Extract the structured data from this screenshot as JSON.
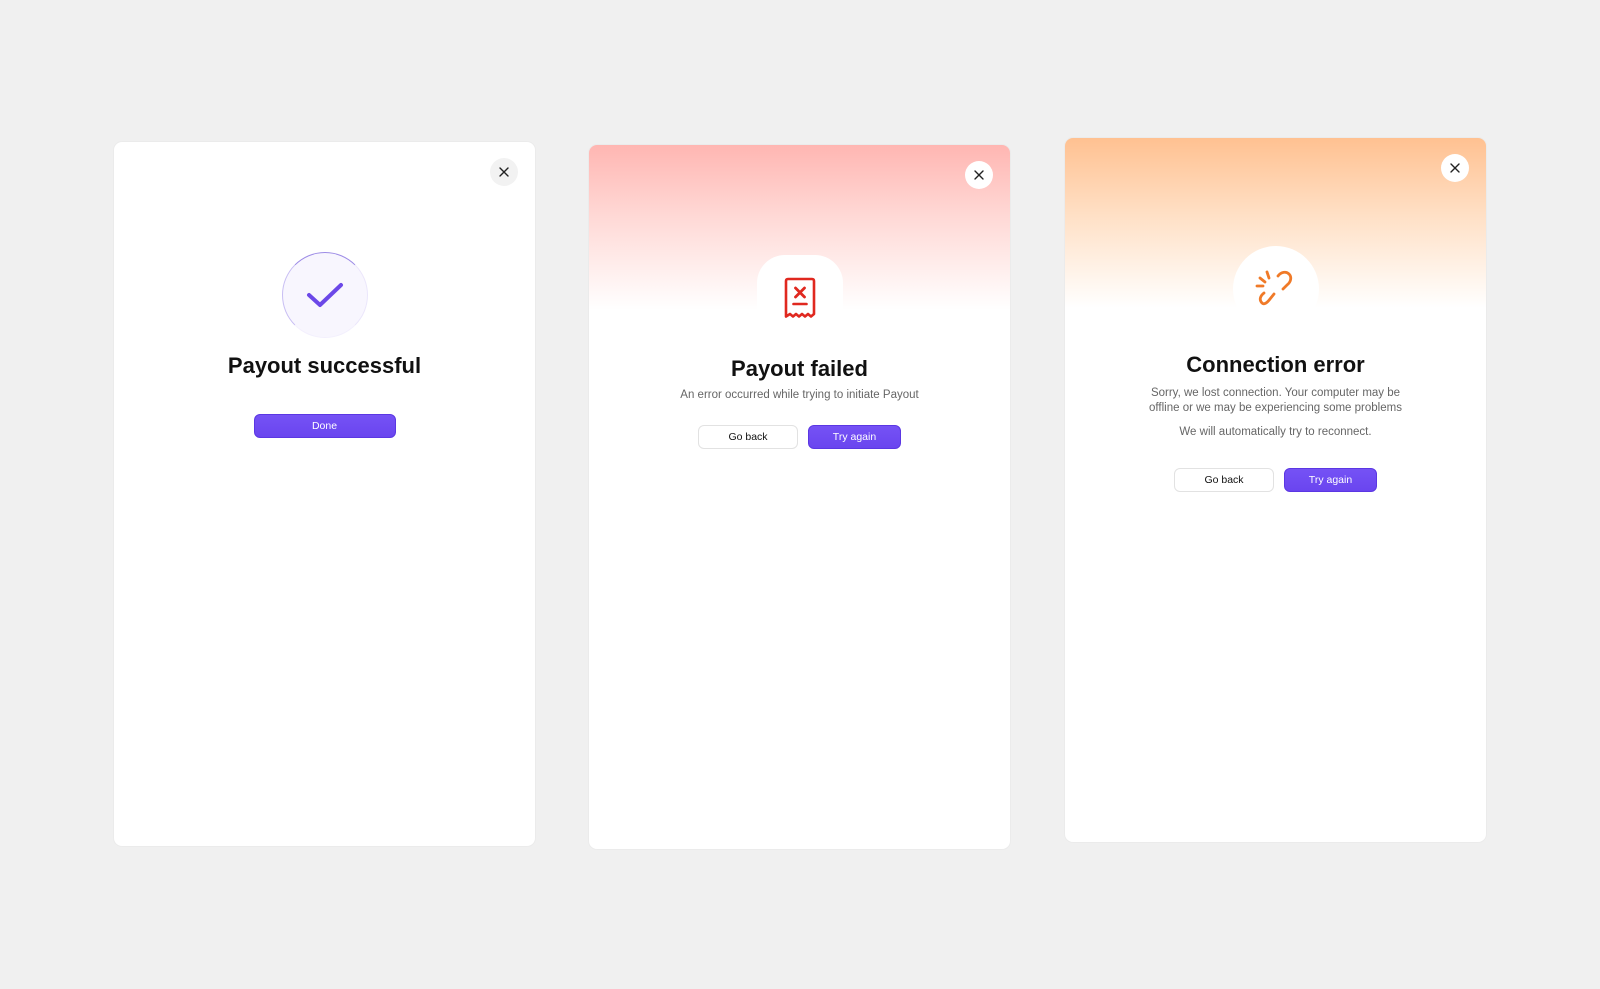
{
  "colors": {
    "background": "#f0f0f0",
    "accent": "#6a45ef",
    "success_check": "#6c48e8",
    "error_red": "#e0281f",
    "warning_orange": "#f07a28"
  },
  "cards": [
    {
      "title": "Payout successful",
      "icon": "checkmark-icon",
      "primary_button": "Done",
      "close_icon": "close-icon"
    },
    {
      "title": "Payout failed",
      "icon": "failed-receipt-icon",
      "description": "An error occurred while trying to initiate Payout",
      "secondary_button": "Go back",
      "primary_button": "Try again",
      "close_icon": "close-icon"
    },
    {
      "title": "Connection error",
      "icon": "broken-link-icon",
      "description_line1": "Sorry, we lost connection. Your computer may be",
      "description_line2": "offline or we may be experiencing some problems",
      "description_2": "We will automatically try to reconnect.",
      "secondary_button": "Go back",
      "primary_button": "Try again",
      "close_icon": "close-icon"
    }
  ]
}
